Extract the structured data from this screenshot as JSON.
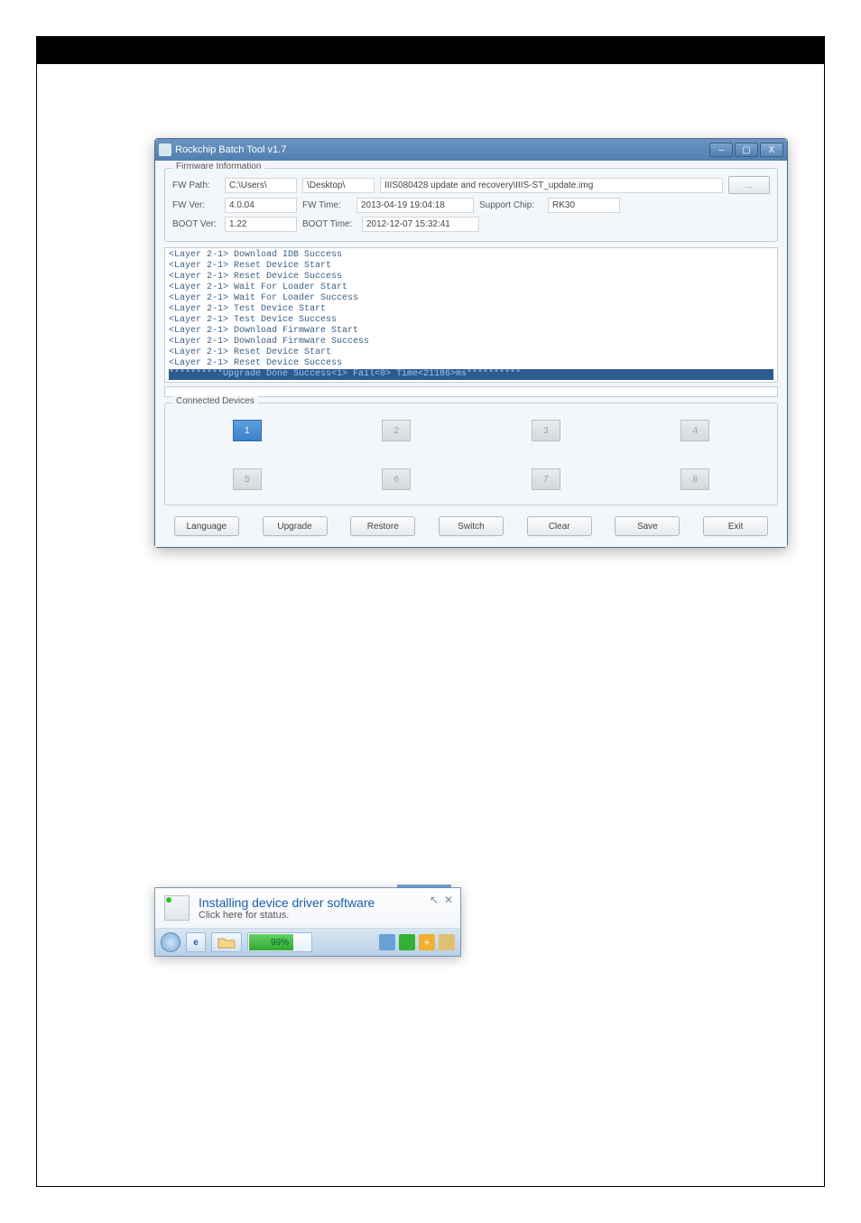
{
  "window": {
    "title": "Rockchip Batch Tool v1.7",
    "min": "–",
    "max": "▢",
    "close": "X"
  },
  "firmware": {
    "legend": "Firmware Information",
    "fwpath_label": "FW Path:",
    "fwpath_val1": "C:\\Users\\",
    "fwpath_val2": "\\Desktop\\",
    "fwpath_val3": "IIIS080428 update and recovery\\IIIS-ST_update.img",
    "browse": "…",
    "fwver_label": "FW Ver:",
    "fwver_val": "4.0.04",
    "fwtime_label": "FW Time:",
    "fwtime_val": "2013-04-19 19:04:18",
    "supportchip_label": "Support Chip:",
    "supportchip_val": "RK30",
    "bootver_label": "BOOT Ver:",
    "bootver_val": "1.22",
    "boottime_label": "BOOT Time:",
    "boottime_val": "2012-12-07 15:32:41"
  },
  "log": {
    "lines": [
      "<Layer 2-1> Download IDB Success",
      "<Layer 2-1> Reset Device Start",
      "<Layer 2-1> Reset Device Success",
      "<Layer 2-1> Wait For Loader Start",
      "<Layer 2-1> Wait For Loader Success",
      "<Layer 2-1> Test Device Start",
      "<Layer 2-1> Test Device Success",
      "<Layer 2-1> Download Firmware Start",
      "<Layer 2-1> Download Firmware Success",
      "<Layer 2-1> Reset Device Start",
      "<Layer 2-1> Reset Device Success"
    ],
    "highlight": "**********Upgrade Done Success<1> Fail<0> Time<21186>ms**********"
  },
  "devices": {
    "legend": "Connected Devices",
    "slots": [
      "1",
      "2",
      "3",
      "4",
      "5",
      "6",
      "7",
      "8"
    ]
  },
  "buttons": {
    "language": "Language",
    "upgrade": "Upgrade",
    "restore": "Restore",
    "switch": "Switch",
    "clear": "Clear",
    "save": "Save",
    "exit": "Exit"
  },
  "balloon": {
    "title": "Installing device driver software",
    "subtitle": "Click here for status.",
    "progress": "99%",
    "plus": "+"
  }
}
